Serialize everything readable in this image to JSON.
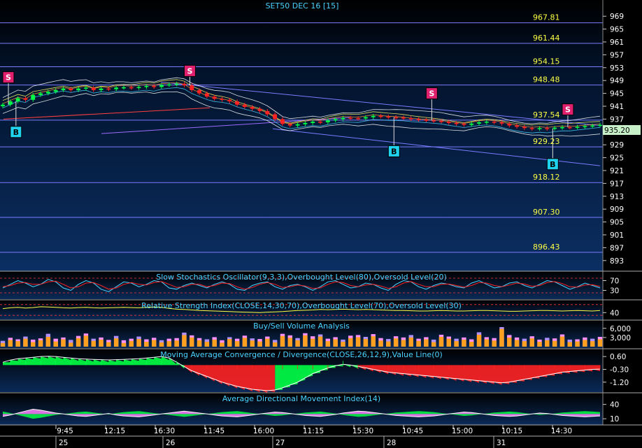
{
  "title": "SET50 DEC 16  [15]",
  "last_price": "935.20",
  "colors": {
    "bg_top": "#000000",
    "bg_bottom": "#0b2f63",
    "grid": "#7b7bff",
    "level_text": "#ffff44",
    "axis_text": "#ffffff",
    "title_text": "#4ad3ff",
    "sell_marker": "#e0206e",
    "buy_marker": "#1fd3ee",
    "price_tag_bg": "#c8f0c8",
    "up_candle": "#00ff44",
    "down_candle": "#ff2222",
    "stoch_k": "#4ad3ff",
    "stoch_d": "#ff2222",
    "rsi": "#ffff44",
    "volume_a": "#ffa020",
    "volume_b": "#b090ff",
    "volume_c": "#ff90ff",
    "macd_pos": "#00ff44",
    "macd_neg": "#ff2222",
    "adx_pos": "#ff80ff",
    "adx_neg": "#00ff44"
  },
  "chart_data": {
    "type": "candlestick",
    "price_axis": {
      "ticks": [
        "969",
        "965",
        "961",
        "957",
        "953",
        "949",
        "945",
        "941",
        "937",
        "933",
        "929",
        "925",
        "921",
        "917",
        "913",
        "909",
        "905",
        "901",
        "897",
        "893"
      ],
      "range": [
        891,
        971
      ]
    },
    "fib_levels": [
      {
        "label": "967.81",
        "value": 967.81
      },
      {
        "label": "961.44",
        "value": 961.44
      },
      {
        "label": "954.15",
        "value": 954.15
      },
      {
        "label": "948.48",
        "value": 948.48
      },
      {
        "label": "937.54",
        "value": 937.54
      },
      {
        "label": "929.23",
        "value": 929.23
      },
      {
        "label": "918.12",
        "value": 918.12
      },
      {
        "label": "907.30",
        "value": 907.3
      },
      {
        "label": "896.43",
        "value": 896.43
      }
    ],
    "price_series": [
      941.5,
      942.5,
      943.5,
      943.0,
      944.5,
      945.0,
      945.5,
      946.0,
      946.5,
      946.0,
      946.5,
      946.8,
      946.0,
      946.5,
      946.3,
      946.8,
      946.9,
      946.7,
      947.0,
      947.3,
      947.0,
      947.6,
      947.8,
      948.0,
      947.5,
      946.0,
      945.0,
      944.0,
      943.3,
      943.0,
      942.5,
      941.5,
      940.8,
      940.2,
      939.5,
      938.5,
      937.0,
      935.5,
      935.0,
      935.4,
      935.8,
      936.2,
      936.0,
      936.6,
      937.0,
      937.4,
      937.3,
      937.2,
      937.6,
      938.0,
      937.8,
      937.6,
      937.5,
      937.3,
      937.0,
      936.8,
      936.6,
      936.4,
      936.2,
      935.8,
      935.5,
      935.2,
      935.6,
      936.0,
      936.2,
      936.0,
      935.6,
      935.0,
      934.6,
      934.2,
      934.0,
      934.2,
      934.0,
      934.3,
      934.5,
      934.4,
      934.6,
      934.8,
      935.0,
      935.2
    ],
    "signals": [
      {
        "label": "S",
        "type": "sell",
        "index": 0,
        "value": 950
      },
      {
        "label": "B",
        "type": "buy",
        "index": 1,
        "value": 933
      },
      {
        "label": "S",
        "type": "sell",
        "index": 24,
        "value": 952
      },
      {
        "label": "S",
        "type": "sell",
        "index": 56,
        "value": 945
      },
      {
        "label": "B",
        "type": "buy",
        "index": 51,
        "value": 927
      },
      {
        "label": "S",
        "type": "sell",
        "index": 74,
        "value": 940
      },
      {
        "label": "B",
        "type": "buy",
        "index": 72,
        "value": 923
      }
    ],
    "time_axis": {
      "ticks": [
        "9:45",
        "12:15",
        "16:30",
        "11:45",
        "16:00",
        "11:15",
        "15:30",
        "10:45",
        "15:00",
        "10:15",
        "14:30"
      ],
      "days": [
        "25",
        "26",
        "27",
        "28",
        "31"
      ]
    },
    "indicators": [
      {
        "name": "stochastic",
        "label": "Slow Stochastics Oscillator(9,3,3),Overbought Level(80),Oversold Level(20)",
        "ticks": [
          "70",
          "30"
        ],
        "range": [
          0,
          100
        ],
        "k": [
          40,
          55,
          70,
          60,
          45,
          55,
          75,
          65,
          40,
          30,
          55,
          70,
          60,
          35,
          25,
          45,
          65,
          60,
          45,
          55,
          70,
          65,
          40,
          35,
          50,
          60,
          50,
          40,
          55,
          65,
          55,
          35,
          30,
          50,
          60,
          65,
          45,
          35,
          50,
          55,
          45,
          30,
          45,
          65,
          70,
          55,
          40,
          45,
          60,
          55,
          40,
          30,
          55,
          70,
          65,
          45,
          35,
          50,
          60,
          55,
          45,
          40,
          60,
          70,
          55,
          40,
          45,
          60,
          65,
          50,
          40,
          55,
          70,
          65,
          50,
          35,
          45,
          60,
          50,
          40
        ],
        "d": [
          45,
          50,
          60,
          62,
          55,
          55,
          65,
          68,
          55,
          40,
          45,
          60,
          62,
          50,
          35,
          40,
          55,
          62,
          55,
          52,
          62,
          66,
          55,
          42,
          45,
          55,
          55,
          45,
          50,
          60,
          58,
          45,
          35,
          42,
          55,
          62,
          55,
          42,
          45,
          52,
          48,
          38,
          40,
          55,
          65,
          62,
          50,
          45,
          52,
          55,
          48,
          38,
          45,
          60,
          66,
          55,
          45,
          45,
          55,
          56,
          50,
          43,
          50,
          62,
          60,
          50,
          45,
          52,
          60,
          56,
          47,
          50,
          62,
          66,
          58,
          45,
          43,
          52,
          53,
          46
        ]
      },
      {
        "name": "rsi",
        "label": "Relative Strength Index(CLOSE,14,30,70),Overbought Level(70),Oversold Level(30)",
        "ticks": [
          "40"
        ],
        "range": [
          20,
          80
        ],
        "values": [
          55,
          58,
          60,
          57,
          59,
          62,
          61,
          60,
          58,
          57,
          59,
          60,
          58,
          57,
          58,
          59,
          60,
          59,
          58,
          60,
          61,
          60,
          56,
          53,
          52,
          50,
          48,
          47,
          46,
          45,
          44,
          43,
          42,
          41,
          40,
          42,
          43,
          44,
          46,
          48,
          49,
          50,
          52,
          51,
          52,
          53,
          52,
          51,
          52,
          51,
          50,
          49,
          48,
          48,
          47,
          46,
          46,
          47,
          48,
          47,
          46,
          46,
          47,
          48,
          48,
          47,
          46,
          45,
          45,
          46,
          47,
          48,
          48,
          47,
          46,
          47,
          48,
          47,
          46,
          48
        ]
      },
      {
        "name": "volume",
        "label": "Buy/Sell Volume Analysis",
        "ticks": [
          "6,000",
          "3,000"
        ],
        "range": [
          0,
          8000
        ],
        "values": [
          1200,
          2200,
          1800,
          2600,
          1500,
          2100,
          3200,
          1700,
          2400,
          1300,
          2800,
          3600,
          1900,
          2300,
          1500,
          2700,
          1200,
          1900,
          2500,
          1600,
          2200,
          1400,
          1800,
          2000,
          3800,
          3000,
          2100,
          1600,
          2300,
          1300,
          2500,
          1800,
          2900,
          2000,
          1700,
          2600,
          1400,
          3500,
          2900,
          2100,
          3700,
          2600,
          3300,
          1800,
          2400,
          1600,
          2800,
          3100,
          2500,
          3400,
          2000,
          1700,
          2700,
          2200,
          3000,
          1900,
          2400,
          1500,
          3200,
          2600,
          1800,
          2300,
          1600,
          3900,
          2400,
          2000,
          5800,
          3000,
          2200,
          1800,
          2700,
          1600,
          2100,
          1900,
          3300,
          1500,
          1700,
          2200,
          1800,
          2400
        ],
        "highlight_values": [
          1900,
          2900,
          2400,
          3300,
          2300,
          2700,
          4200,
          2600,
          3000,
          2200,
          3500,
          4300,
          2600,
          3000,
          2200,
          3500,
          2100,
          2600,
          3300,
          2400,
          2900,
          2100,
          2600,
          2800,
          4600,
          3700,
          2800,
          2400,
          3100,
          2100,
          3100,
          2600,
          3600,
          2700,
          2500,
          3300,
          2200,
          4200,
          3700,
          2800,
          4400,
          3400,
          4000,
          2600,
          3100,
          2300,
          3600,
          3800,
          3200,
          4100,
          2800,
          2500,
          3400,
          3000,
          3800,
          2600,
          3100,
          2300,
          3900,
          3300,
          2600,
          3000,
          2400,
          4700,
          3100,
          2800,
          6400,
          3800,
          3000,
          2600,
          3400,
          2300,
          2900,
          2700,
          4000,
          2300,
          2400,
          3000,
          2600,
          3200
        ]
      },
      {
        "name": "macd",
        "label": "Moving Average Convergence / Divergence(CLOSE,26,12,9),Value Line(0)",
        "ticks": [
          "0.60",
          "-0.30",
          "-1.20"
        ],
        "range": [
          -1.8,
          1.0
        ],
        "values": [
          0.2,
          0.35,
          0.45,
          0.5,
          0.55,
          0.6,
          0.62,
          0.6,
          0.55,
          0.5,
          0.45,
          0.42,
          0.4,
          0.38,
          0.36,
          0.38,
          0.4,
          0.42,
          0.45,
          0.5,
          0.55,
          0.6,
          0.5,
          0.2,
          -0.1,
          -0.4,
          -0.6,
          -0.8,
          -1.0,
          -1.2,
          -1.35,
          -1.5,
          -1.6,
          -1.7,
          -1.75,
          -1.8,
          -1.75,
          -1.6,
          -1.4,
          -1.2,
          -0.9,
          -0.6,
          -0.4,
          -0.2,
          -0.05,
          0.05,
          0.0,
          -0.1,
          -0.2,
          -0.3,
          -0.4,
          -0.5,
          -0.55,
          -0.6,
          -0.65,
          -0.7,
          -0.75,
          -0.8,
          -0.85,
          -0.9,
          -0.95,
          -1.0,
          -1.05,
          -1.1,
          -1.15,
          -1.2,
          -1.25,
          -1.2,
          -1.1,
          -1.0,
          -0.9,
          -0.8,
          -0.7,
          -0.6,
          -0.5,
          -0.45,
          -0.4,
          -0.35,
          -0.3,
          -0.28
        ]
      },
      {
        "name": "adx",
        "label": "Average Directional Movement Index(14)",
        "ticks": [
          "40",
          "10"
        ],
        "range": [
          0,
          60
        ],
        "values": [
          15,
          18,
          22,
          26,
          30,
          28,
          25,
          22,
          20,
          18,
          16,
          15,
          17,
          19,
          21,
          18,
          16,
          15,
          14,
          16,
          18,
          20,
          22,
          24,
          26,
          24,
          22,
          20,
          18,
          16,
          15,
          14,
          16,
          18,
          20,
          22,
          24,
          23,
          21,
          19,
          17,
          16,
          15,
          17,
          19,
          22,
          24,
          26,
          25,
          23,
          21,
          19,
          17,
          16,
          15,
          14,
          15,
          16,
          18,
          20,
          22,
          24,
          23,
          21,
          19,
          17,
          16,
          15,
          16,
          18,
          20,
          22,
          21,
          19,
          17,
          16,
          15,
          14,
          15,
          16
        ]
      }
    ]
  }
}
